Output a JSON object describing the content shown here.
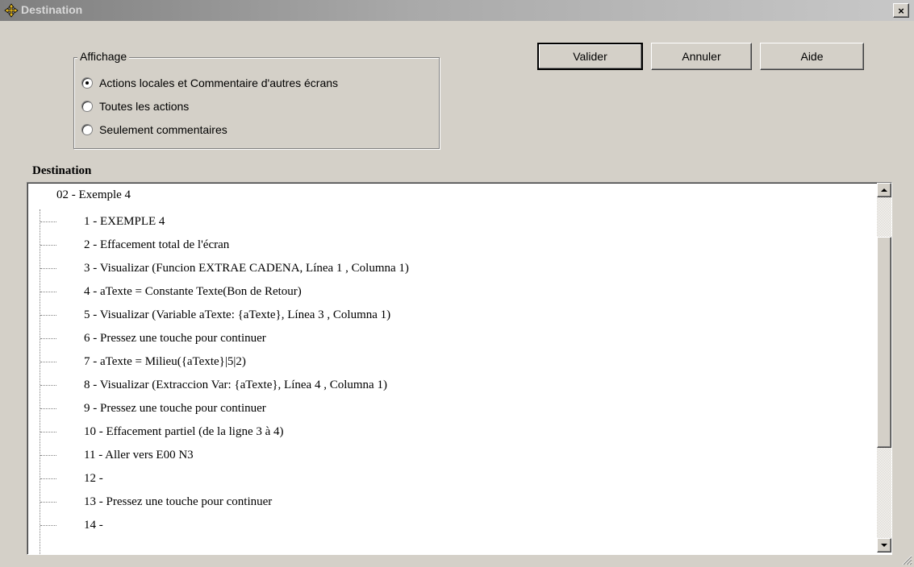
{
  "window": {
    "title": "Destination",
    "close_label": "×"
  },
  "display_group": {
    "legend": "Affichage",
    "options": [
      {
        "label": "Actions locales et Commentaire d'autres écrans",
        "selected": true
      },
      {
        "label": "Toutes les actions",
        "selected": false
      },
      {
        "label": "Seulement commentaires",
        "selected": false
      }
    ]
  },
  "buttons": {
    "validate": "Valider",
    "cancel": "Annuler",
    "help": "Aide"
  },
  "tree": {
    "section_label": "Destination",
    "root": "02 - Exemple 4",
    "items": [
      "1 - EXEMPLE 4",
      "2 - Effacement total de l'écran",
      "3 - Visualizar (Funcion EXTRAE CADENA, Línea 1 , Columna 1)",
      "4 - aTexte = Constante Texte(Bon de Retour)",
      "5 - Visualizar (Variable aTexte: {aTexte}, Línea 3 , Columna 1)",
      "6 - Pressez une touche pour continuer",
      "7 - aTexte = Milieu({aTexte}|5|2)",
      "8 - Visualizar (Extraccion Var: {aTexte}, Línea 4 , Columna 1)",
      "9 - Pressez une touche pour continuer",
      "10 - Effacement partiel (de la ligne 3 à 4)",
      "11 - Aller vers E00 N3",
      "12 -",
      "13 - Pressez une touche pour continuer",
      "14 -"
    ]
  }
}
